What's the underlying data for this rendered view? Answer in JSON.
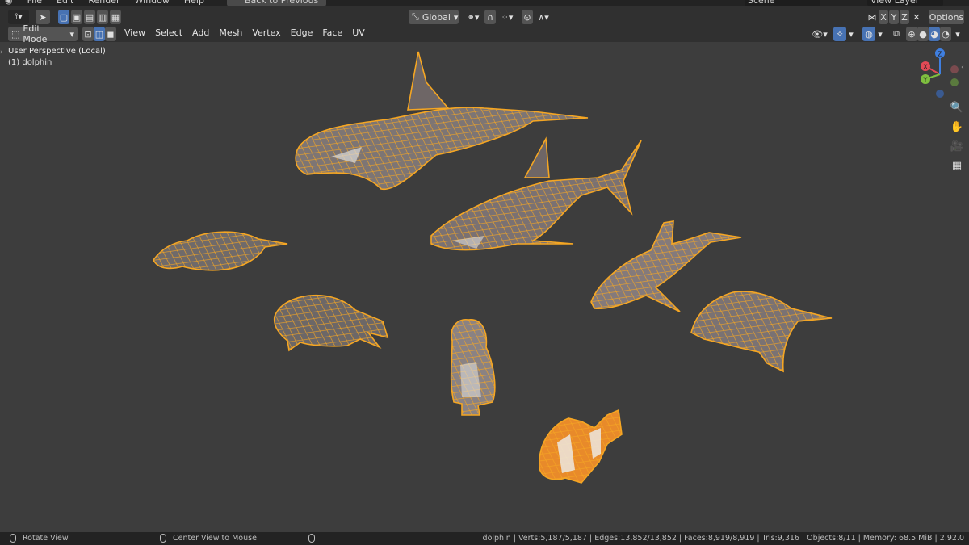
{
  "app": {
    "menu": [
      "File",
      "Edit",
      "Render",
      "Window",
      "Help"
    ],
    "back_button": "Back to Previous",
    "scene": "Scene",
    "view_layer": "View Layer"
  },
  "header": {
    "transform_orientation": "Global",
    "options_label": "Options",
    "axis_x": "X",
    "axis_y": "Y",
    "axis_z": "Z"
  },
  "editbar": {
    "mode": "Edit Mode",
    "menus": [
      "View",
      "Select",
      "Add",
      "Mesh",
      "Vertex",
      "Edge",
      "Face",
      "UV"
    ]
  },
  "viewport": {
    "perspective_label": "User Perspective (Local)",
    "object_label": "(1) dolphin",
    "wire_color": "#f5a623",
    "fill_color": "#8a7f80",
    "gizmo": {
      "x_label": "X",
      "y_label": "Y",
      "z_label": "Z"
    }
  },
  "status": {
    "hint_rotate": "Rotate View",
    "hint_center": "Center View to Mouse",
    "stats": "dolphin | Verts:5,187/5,187 | Edges:13,852/13,852 | Faces:8,919/8,919 | Tris:9,316 | Objects:8/11 | Memory: 68.5 MiB | 2.92.0"
  },
  "colors": {
    "background": "#3d3d3d",
    "header": "#303030",
    "active": "#4772b3",
    "axis_x": "#e34a56",
    "axis_y": "#7fbf3f",
    "axis_z": "#3f7fe0"
  }
}
